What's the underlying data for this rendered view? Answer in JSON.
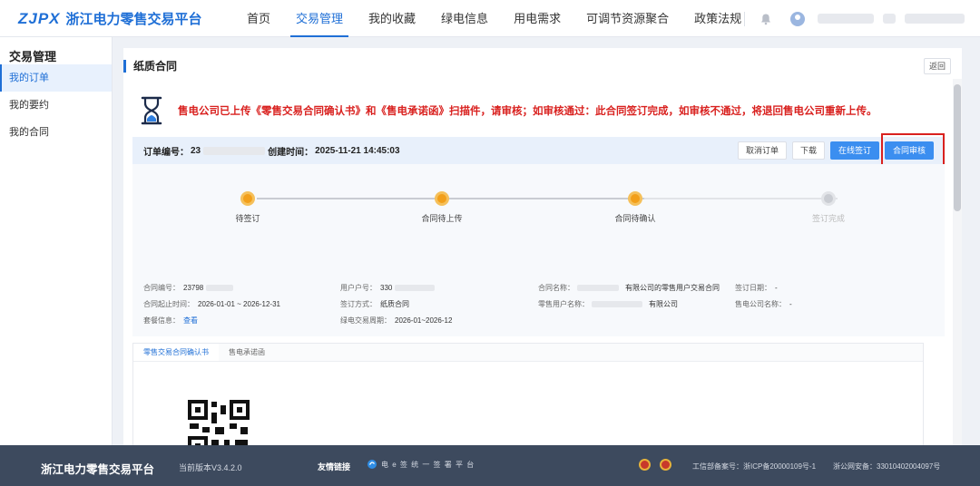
{
  "header": {
    "logo_mark": "ZJPX",
    "logo_text": "浙江电力零售交易平台",
    "nav": [
      {
        "label": "首页",
        "active": false
      },
      {
        "label": "交易管理",
        "active": true
      },
      {
        "label": "我的收藏",
        "active": false
      },
      {
        "label": "绿电信息",
        "active": false
      },
      {
        "label": "用电需求",
        "active": false
      },
      {
        "label": "可调节资源聚合",
        "active": false
      },
      {
        "label": "政策法规",
        "active": false
      }
    ],
    "icons": [
      "bell-icon",
      "user-avatar-icon"
    ]
  },
  "sidebar": {
    "title": "交易管理",
    "items": [
      {
        "label": "我的订单",
        "active": true
      },
      {
        "label": "我的要约",
        "active": false
      },
      {
        "label": "我的合同",
        "active": false
      }
    ]
  },
  "panel": {
    "title": "纸质合同",
    "back_label": "返回",
    "notice": "售电公司已上传《零售交易合同确认书》和《售电承诺函》扫描件，请审核；如审核通过：此合同签订完成，如审核不通过，将退回售电公司重新上传。",
    "order": {
      "no_label": "订单编号：",
      "no_value": "23",
      "created_label": "创建时间：",
      "created_value": "2025-11-21 14:45:03"
    },
    "buttons": {
      "cancel": "取消订单",
      "download": "下载",
      "sign_online": "在线签订",
      "review": "合同审核"
    },
    "steps": [
      {
        "label": "待签订",
        "done": true
      },
      {
        "label": "合同待上传",
        "done": true
      },
      {
        "label": "合同待确认",
        "done": true
      },
      {
        "label": "签订完成",
        "done": false
      }
    ],
    "info": {
      "contract_no_label": "合同编号：",
      "contract_no_value": "23798",
      "user_no_label": "用户户号：",
      "user_no_value": "330",
      "contract_name_label": "合同名称：",
      "contract_name_value": "有限公司的零售用户交易合同",
      "sign_date_label": "签订日期：",
      "sign_date_value": "-",
      "period_label": "合同起止时间：",
      "period_value": "2026-01-01 ~ 2026-12-31",
      "sign_method_label": "签订方式：",
      "sign_method_value": "纸质合同",
      "retail_user_label": "零售用户名称：",
      "retail_user_value": "有限公司",
      "seller_label": "售电公司名称：",
      "seller_value": "-",
      "package_label": "套餐信息：",
      "package_link": "查看",
      "green_period_label": "绿电交易周期：",
      "green_period_value": "2026-01~2026-12"
    },
    "tabs": [
      {
        "label": "零售交易合同确认书",
        "active": true
      },
      {
        "label": "售电承诺函",
        "active": false
      }
    ]
  },
  "footer": {
    "logo": "浙江电力零售交易平台",
    "version": "当前版本V3.4.2.0",
    "links_label": "友情链接",
    "esign": "电 e 签 统 一 签 署 平 台",
    "icp": "工信部备案号：浙ICP备20000109号-1",
    "police": "浙公网安备：33010402004097号"
  }
}
